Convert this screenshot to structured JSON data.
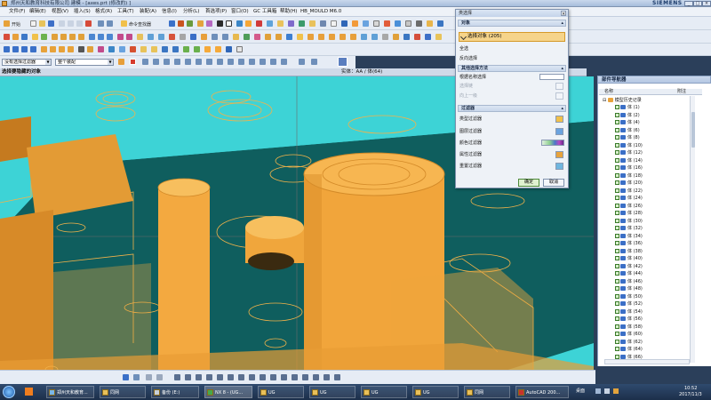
{
  "window": {
    "title": "郑州天和教育科技有限公司   建模 - [axes.prt   (修改的) ]",
    "brand": "SIEMENS",
    "controls": [
      "_",
      "□",
      "×"
    ]
  },
  "menubar": {
    "items": [
      "文件(F)",
      "编辑(E)",
      "视图(V)",
      "插入(S)",
      "格式(R)",
      "工具(T)",
      "装配(A)",
      "信息(I)",
      "分析(L)",
      "首选项(P)",
      "窗口(O)",
      "GC 工具箱",
      "帮助(H)",
      "HB_MOULD M6.0"
    ]
  },
  "toolbar": {
    "start_label": "开始",
    "command_finder": "命令查找器",
    "filter_label": "没有选择过滤器",
    "scope_label": "整个装配"
  },
  "graphics": {
    "prompt": "选择要隐藏的对象",
    "status": "实体：AA / 体(64)"
  },
  "dialog": {
    "title": "类选择",
    "section_object": "对象",
    "selected": "选择对象 (205)",
    "select_all": "全选",
    "invert": "反向选择",
    "section_other": "其他选择方法",
    "by_name": "根据名称选择",
    "select_chain": "选择链",
    "up_level": "向上一级",
    "section_filter": "过滤器",
    "filters": [
      "类型过滤器",
      "图层过滤器",
      "颜色过滤器",
      "属性过滤器",
      "重置过滤器"
    ],
    "ok": "确定",
    "cancel": "取消"
  },
  "navigator": {
    "title": "部件导航器",
    "col_name": "名称",
    "col_latest": "附注",
    "root": "模型历史记录",
    "items": [
      "体 (1)",
      "体 (2)",
      "体 (4)",
      "体 (6)",
      "体 (8)",
      "体 (10)",
      "体 (12)",
      "体 (14)",
      "体 (16)",
      "体 (18)",
      "体 (20)",
      "体 (22)",
      "体 (24)",
      "体 (26)",
      "体 (28)",
      "体 (30)",
      "体 (32)",
      "体 (34)",
      "体 (36)",
      "体 (38)",
      "体 (40)",
      "体 (42)",
      "体 (44)",
      "体 (46)",
      "体 (48)",
      "体 (50)",
      "体 (52)",
      "体 (54)",
      "体 (56)",
      "体 (58)",
      "体 (60)",
      "体 (62)",
      "体 (64)",
      "体 (66)"
    ]
  },
  "taskbar": {
    "items": [
      "郑州天和教育...",
      "同网",
      "备份 (E:)",
      "NX 8 - (UG...",
      "UG",
      "UG",
      "UG",
      "UG",
      "同网",
      "AutoCAD 200..."
    ],
    "tray_lang": "桌面",
    "time": "10:52",
    "date": "2017/11/3"
  },
  "colors": {
    "viewport_bg": "#3dd3d6",
    "ground": "#0f5e5e",
    "solid": "#f0a63c",
    "accent": "#f6d48a"
  }
}
